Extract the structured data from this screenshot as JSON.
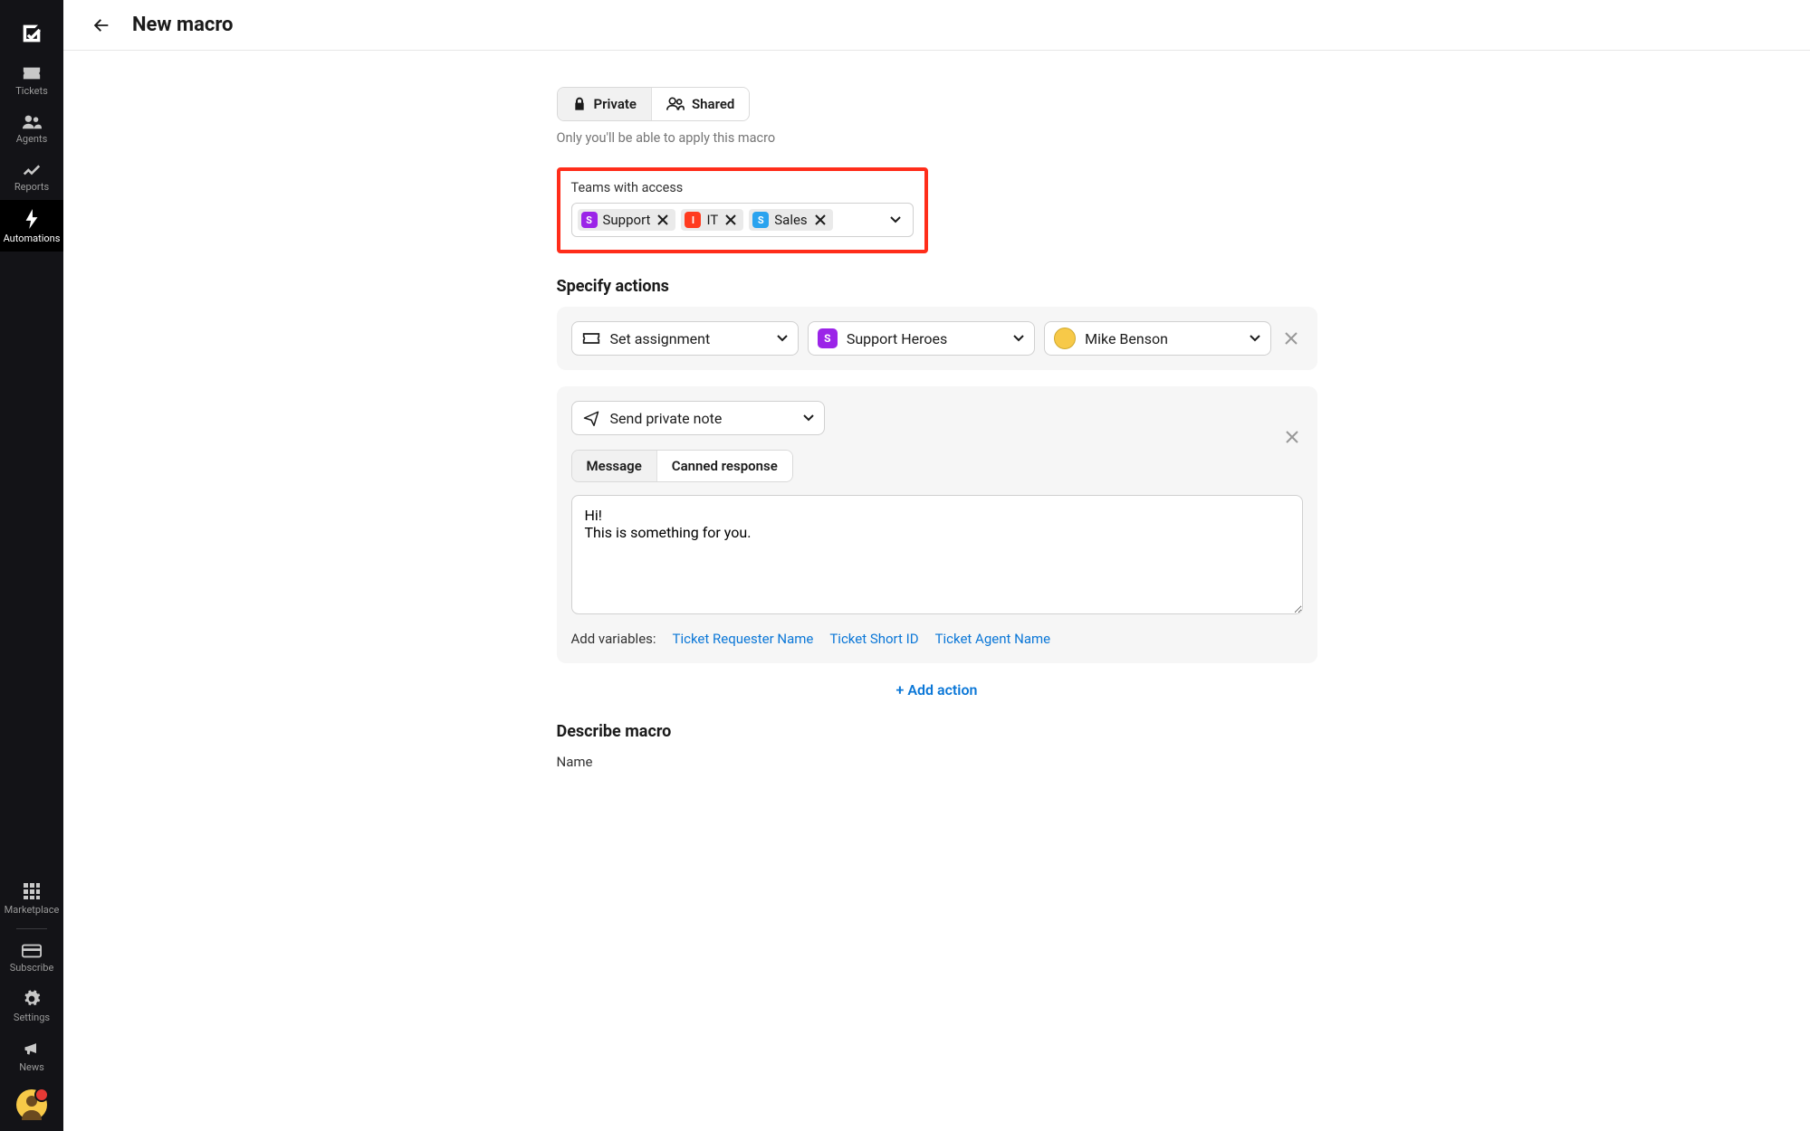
{
  "sidebar": {
    "items": [
      {
        "label": "Tickets"
      },
      {
        "label": "Agents"
      },
      {
        "label": "Reports"
      },
      {
        "label": "Automations"
      },
      {
        "label": "Marketplace"
      },
      {
        "label": "Subscribe"
      },
      {
        "label": "Settings"
      },
      {
        "label": "News"
      }
    ]
  },
  "header": {
    "title": "New macro"
  },
  "visibility": {
    "private_label": "Private",
    "shared_label": "Shared",
    "help": "Only you'll be able to apply this macro"
  },
  "teams": {
    "label": "Teams with access",
    "tags": [
      {
        "badge": "S",
        "color": "#9b24e8",
        "name": "Support"
      },
      {
        "badge": "I",
        "color": "#ff3b1f",
        "name": "IT"
      },
      {
        "badge": "S",
        "color": "#2aa3ef",
        "name": "Sales"
      }
    ]
  },
  "actions": {
    "title": "Specify actions",
    "row1": {
      "action_label": "Set assignment",
      "team_label": "Support Heroes",
      "agent_label": "Mike Benson"
    },
    "row2": {
      "action_label": "Send private note",
      "tabs": {
        "message": "Message",
        "canned": "Canned response"
      },
      "message_text": "Hi!\nThis is something for you.",
      "vars_label": "Add variables:",
      "vars": [
        "Ticket Requester Name",
        "Ticket Short ID",
        "Ticket Agent Name"
      ]
    },
    "add_action_label": "+ Add action"
  },
  "describe": {
    "title": "Describe macro",
    "name_label": "Name"
  }
}
